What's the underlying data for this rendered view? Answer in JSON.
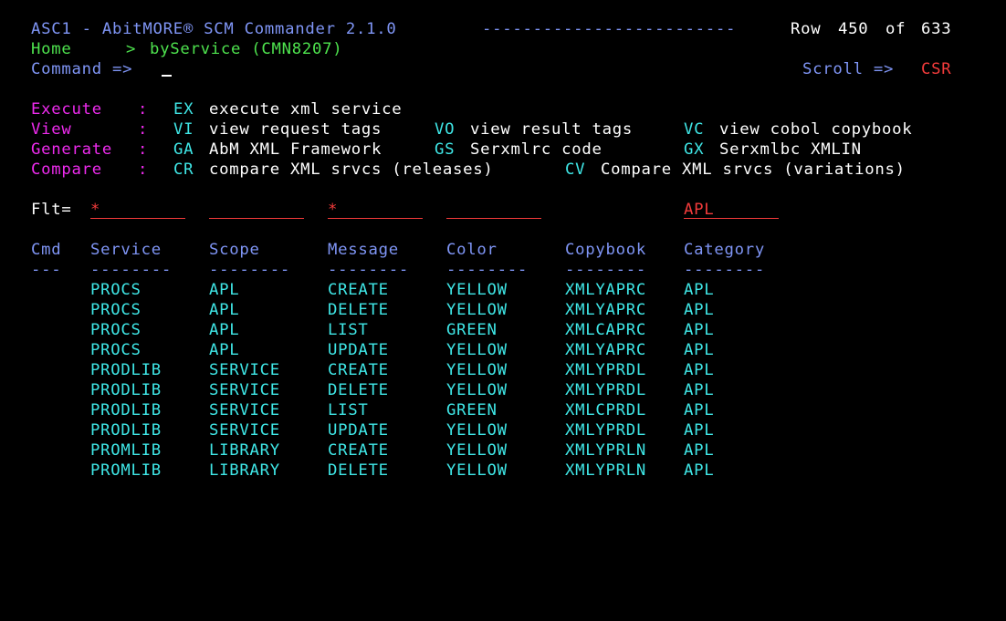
{
  "header": {
    "title": "ASC1 - AbitMORE® SCM Commander 2.1.0",
    "dashes": "-------------------------",
    "row_label": "Row",
    "row_current": "450",
    "row_of": "of",
    "row_total": "633",
    "breadcrumb_home": "Home",
    "breadcrumb_sep": ">",
    "breadcrumb_current": "byService (CMN8207)",
    "command_label": "Command =>",
    "command_value": "",
    "scroll_label": "Scroll =>",
    "scroll_value": "CSR"
  },
  "actions": [
    {
      "group": "Execute",
      "colon": ":",
      "items": [
        {
          "code": "EX",
          "label": "execute xml service"
        }
      ]
    },
    {
      "group": "View",
      "colon": ":",
      "items": [
        {
          "code": "VI",
          "label": "view request tags"
        },
        {
          "code": "VO",
          "label": "view result tags"
        },
        {
          "code": "VC",
          "label": "view cobol copybook"
        }
      ]
    },
    {
      "group": "Generate",
      "colon": ":",
      "items": [
        {
          "code": "GA",
          "label": "AbM XML Framework"
        },
        {
          "code": "GS",
          "label": "Serxmlrc code"
        },
        {
          "code": "GX",
          "label": "Serxmlbc XMLIN"
        }
      ]
    },
    {
      "group": "Compare",
      "colon": ":",
      "items": [
        {
          "code": "CR",
          "label": "compare XML srvcs (releases)"
        },
        {
          "code": "CV",
          "label": "Compare XML srvcs (variations)"
        }
      ]
    }
  ],
  "filter": {
    "label": "Flt=",
    "service": "*",
    "scope": "",
    "message": "*",
    "color": "",
    "category": "APL"
  },
  "table": {
    "columns": [
      "Cmd",
      "Service",
      "Scope",
      "Message",
      "Color",
      "Copybook",
      "Category"
    ],
    "separators": [
      "---",
      "--------",
      "--------",
      "--------",
      "--------",
      "--------",
      "--------"
    ],
    "rows": [
      {
        "cmd": "",
        "service": "PROCS",
        "scope": "APL",
        "message": "CREATE",
        "color": "YELLOW",
        "copybook": "XMLYAPRC",
        "category": "APL"
      },
      {
        "cmd": "",
        "service": "PROCS",
        "scope": "APL",
        "message": "DELETE",
        "color": "YELLOW",
        "copybook": "XMLYAPRC",
        "category": "APL"
      },
      {
        "cmd": "",
        "service": "PROCS",
        "scope": "APL",
        "message": "LIST",
        "color": "GREEN",
        "copybook": "XMLCAPRC",
        "category": "APL"
      },
      {
        "cmd": "",
        "service": "PROCS",
        "scope": "APL",
        "message": "UPDATE",
        "color": "YELLOW",
        "copybook": "XMLYAPRC",
        "category": "APL"
      },
      {
        "cmd": "",
        "service": "PRODLIB",
        "scope": "SERVICE",
        "message": "CREATE",
        "color": "YELLOW",
        "copybook": "XMLYPRDL",
        "category": "APL"
      },
      {
        "cmd": "",
        "service": "PRODLIB",
        "scope": "SERVICE",
        "message": "DELETE",
        "color": "YELLOW",
        "copybook": "XMLYPRDL",
        "category": "APL"
      },
      {
        "cmd": "",
        "service": "PRODLIB",
        "scope": "SERVICE",
        "message": "LIST",
        "color": "GREEN",
        "copybook": "XMLCPRDL",
        "category": "APL"
      },
      {
        "cmd": "",
        "service": "PRODLIB",
        "scope": "SERVICE",
        "message": "UPDATE",
        "color": "YELLOW",
        "copybook": "XMLYPRDL",
        "category": "APL"
      },
      {
        "cmd": "",
        "service": "PROMLIB",
        "scope": "LIBRARY",
        "message": "CREATE",
        "color": "YELLOW",
        "copybook": "XMLYPRLN",
        "category": "APL"
      },
      {
        "cmd": "",
        "service": "PROMLIB",
        "scope": "LIBRARY",
        "message": "DELETE",
        "color": "YELLOW",
        "copybook": "XMLYPRLN",
        "category": "APL"
      }
    ]
  },
  "colors": {
    "background": "#000000",
    "blue": "#7f95f5",
    "green": "#4ee34e",
    "white": "#ffffff",
    "red": "#f33b3b",
    "magenta": "#ee2bee",
    "turquoise": "#3fe6e6"
  }
}
